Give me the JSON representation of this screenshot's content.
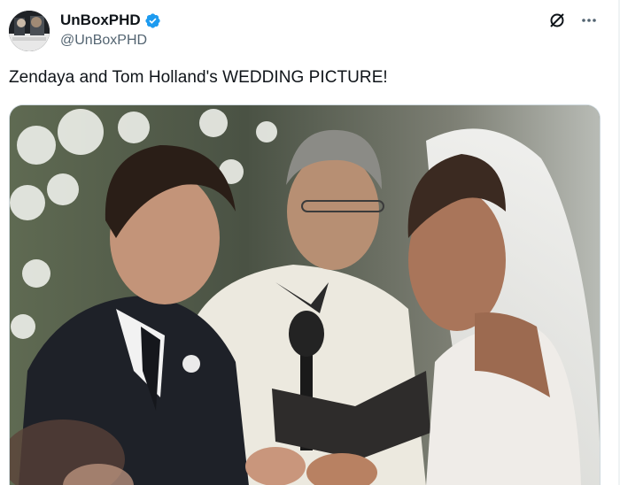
{
  "author": {
    "display_name": "UnBoxPHD",
    "handle": "@UnBoxPHD",
    "verified_color": "#1d9bf0"
  },
  "post": {
    "text": "Zendaya and Tom Holland's WEDDING PICTURE!"
  },
  "icons": {
    "verified": "verified-badge-icon",
    "grok": "grok-icon",
    "more": "more-horizontal-icon"
  }
}
